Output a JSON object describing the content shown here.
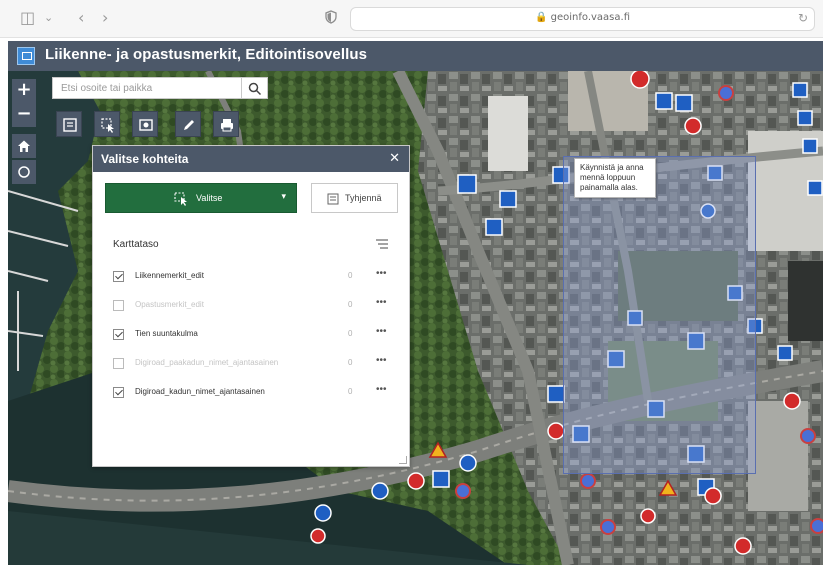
{
  "browser": {
    "url": "geoinfo.vaasa.fi"
  },
  "app": {
    "title": "Liikenne- ja opastusmerkit, Editointisovellus"
  },
  "map_tools": {
    "zoom_in": "+",
    "zoom_out": "−",
    "search_placeholder": "Etsi osoite tai paikka"
  },
  "tooltip": {
    "text": "Käynnistä ja anna mennä loppuun painamalla alas."
  },
  "panel": {
    "title": "Valitse kohteita",
    "close": "✕",
    "select_label": "Valitse",
    "clear_label": "Tyhjennä",
    "layer_heading": "Karttataso",
    "layers": [
      {
        "name": "Liikennemerkit_edit",
        "checked": true,
        "count": "0",
        "enabled": true
      },
      {
        "name": "Opastusmerkit_edit",
        "checked": false,
        "count": "0",
        "enabled": false
      },
      {
        "name": "Tien suuntakulma",
        "checked": true,
        "count": "0",
        "enabled": true
      },
      {
        "name": "Digiroad_paakadun_nimet_ajantasainen",
        "checked": false,
        "count": "0",
        "enabled": false
      },
      {
        "name": "Digiroad_kadun_nimet_ajantasainen",
        "checked": true,
        "count": "0",
        "enabled": true
      }
    ],
    "more": "•••"
  },
  "colors": {
    "header": "#4c5869",
    "select_button": "#226e3e",
    "sign_blue": "#1f5fc2",
    "sign_red": "#d22b2b"
  }
}
